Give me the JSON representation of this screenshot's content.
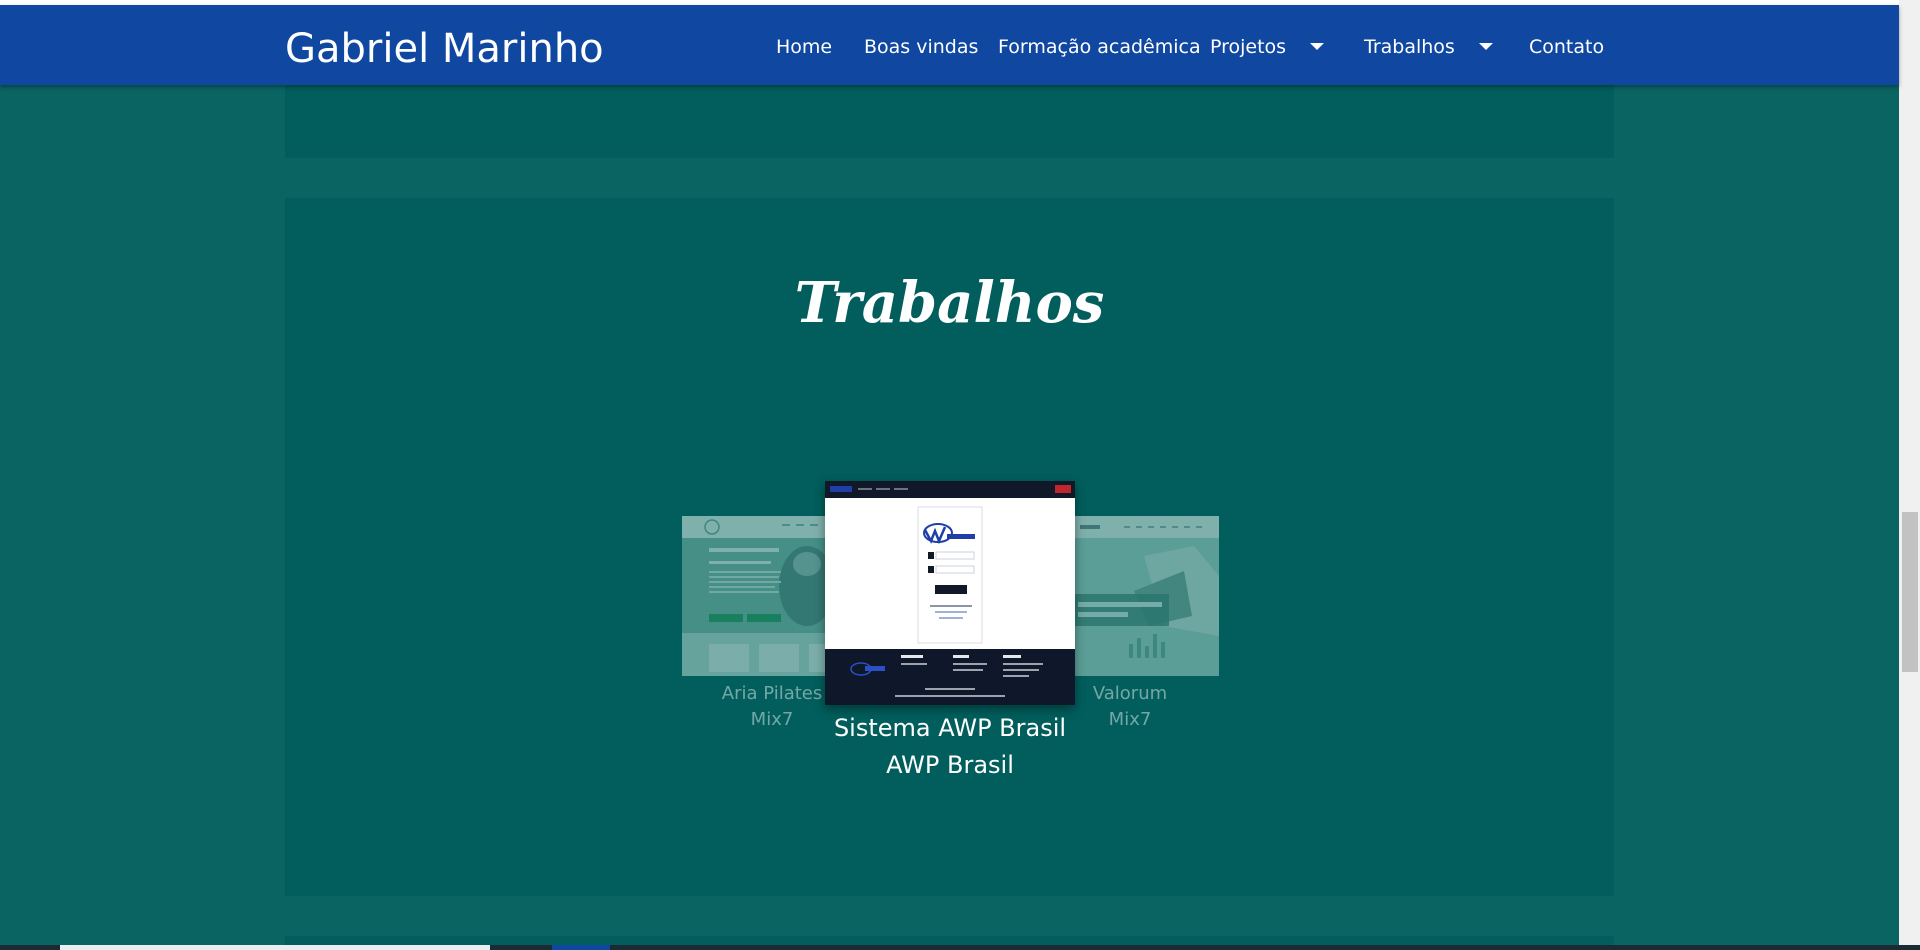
{
  "navbar": {
    "brand": "Gabriel Marinho",
    "items": [
      {
        "label": "Home",
        "dropdown": false
      },
      {
        "label": "Boas vindas",
        "dropdown": false
      },
      {
        "label": "Formação acadêmica",
        "dropdown": false
      },
      {
        "label": "Projetos",
        "dropdown": true
      },
      {
        "label": "Trabalhos",
        "dropdown": true
      },
      {
        "label": "Contato",
        "dropdown": false
      }
    ]
  },
  "section": {
    "title": "Trabalhos"
  },
  "carousel": {
    "left": {
      "name": "Aria Pilates",
      "company": "Mix7"
    },
    "center": {
      "name": "Sistema AWP Brasil",
      "company": "AWP Brasil"
    },
    "right": {
      "name": "Valorum",
      "company": "Mix7"
    }
  },
  "colors": {
    "navbar": "#0f47a1",
    "page_background": "#0a6462",
    "panel_background": "#015e5c",
    "text": "#ffffff"
  },
  "icons": [
    "caret-down-icon"
  ]
}
